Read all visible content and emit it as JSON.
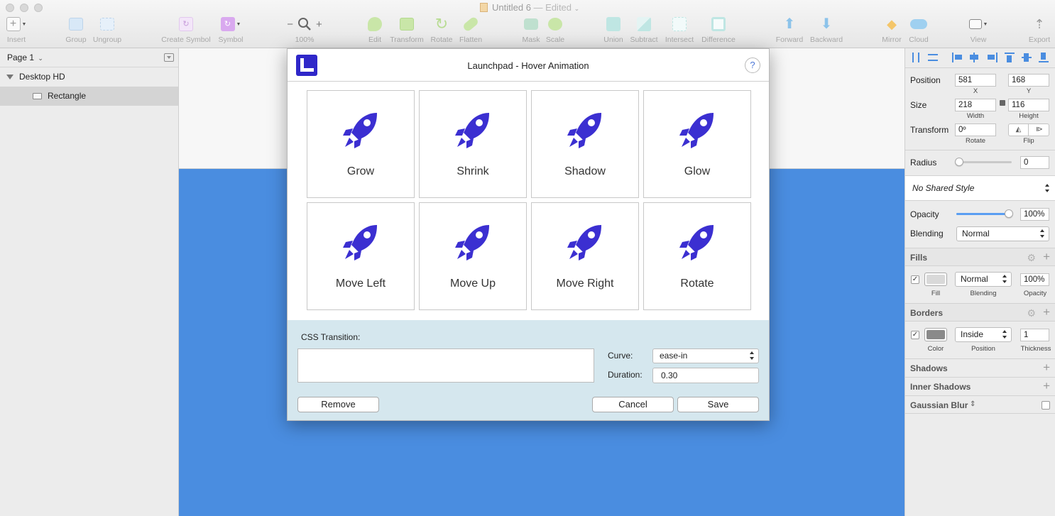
{
  "window": {
    "title": "Untitled 6",
    "edited_suffix": "— Edited"
  },
  "toolbar": {
    "insert": "Insert",
    "group": "Group",
    "ungroup": "Ungroup",
    "create_symbol": "Create Symbol",
    "symbol": "Symbol",
    "zoom_minus": "−",
    "zoom_plus": "+",
    "zoom_level": "100%",
    "edit": "Edit",
    "transform": "Transform",
    "rotate": "Rotate",
    "flatten": "Flatten",
    "mask": "Mask",
    "scale": "Scale",
    "union": "Union",
    "subtract": "Subtract",
    "intersect": "Intersect",
    "difference": "Difference",
    "forward": "Forward",
    "backward": "Backward",
    "mirror": "Mirror",
    "cloud": "Cloud",
    "view": "View",
    "export": "Export"
  },
  "layers_panel": {
    "page_label": "Page 1",
    "artboard_name": "Desktop HD",
    "layer_name": "Rectangle"
  },
  "dialog": {
    "title": "Launchpad - Hover Animation",
    "help": "?",
    "animations": [
      "Grow",
      "Shrink",
      "Shadow",
      "Glow",
      "Move Left",
      "Move Up",
      "Move Right",
      "Rotate"
    ],
    "css_transition_label": "CSS Transition:",
    "css_transition_value": "",
    "curve_label": "Curve:",
    "curve_value": "ease-in",
    "duration_label": "Duration:",
    "duration_value": "0.30",
    "remove_button": "Remove",
    "cancel_button": "Cancel",
    "save_button": "Save"
  },
  "inspector": {
    "position_label": "Position",
    "x_value": "581",
    "x_label": "X",
    "y_value": "168",
    "y_label": "Y",
    "size_label": "Size",
    "width_value": "218",
    "width_label": "Width",
    "height_value": "116",
    "height_label": "Height",
    "transform_label": "Transform",
    "rotate_value": "0º",
    "rotate_label": "Rotate",
    "flip_label": "Flip",
    "radius_label": "Radius",
    "radius_value": "0",
    "shared_style": "No Shared Style",
    "opacity_label": "Opacity",
    "opacity_value": "100%",
    "opacity_level": 1.0,
    "blending_label": "Blending",
    "blending_value": "Normal",
    "fills_title": "Fills",
    "fill_label": "Fill",
    "fill_blending_value": "Normal",
    "fill_blending_label": "Blending",
    "fill_opacity_value": "100%",
    "fill_opacity_label": "Opacity",
    "borders_title": "Borders",
    "border_color_label": "Color",
    "border_position_value": "Inside",
    "border_position_label": "Position",
    "border_thickness_value": "1",
    "border_thickness_label": "Thickness",
    "shadows_title": "Shadows",
    "inner_shadows_title": "Inner Shadows",
    "gaussian_blur_title": "Gaussian Blur",
    "check_mark": "✓"
  },
  "colors": {
    "artboard_fill": "#4a8de0",
    "rocket": "#3b2fd1",
    "fill_swatch": "#d9d9d9",
    "border_swatch": "#8a8a8a",
    "slider_accent": "#5a9ef2"
  }
}
